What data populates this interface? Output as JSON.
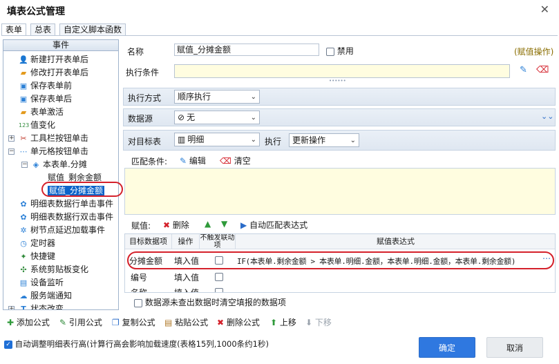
{
  "window": {
    "title": "填表公式管理",
    "close": "✕"
  },
  "tabs": [
    "表单",
    "总表",
    "自定义脚本函数"
  ],
  "tree": {
    "header": "事件",
    "items": [
      {
        "label": "新建打开表单后",
        "icon": "user-add-icon"
      },
      {
        "label": "修改打开表单后",
        "icon": "folder-open-icon"
      },
      {
        "label": "保存表单前",
        "icon": "save-icon"
      },
      {
        "label": "保存表单后",
        "icon": "save-done-icon"
      },
      {
        "label": "表单激活",
        "icon": "folder-icon"
      },
      {
        "label": "值变化",
        "icon": "number-icon"
      },
      {
        "label": "工具栏按钮单击",
        "icon": "tools-icon"
      },
      {
        "label": "单元格按钮单击",
        "icon": "dots-icon"
      },
      {
        "label": "本表单.分摊",
        "icon": "layers-icon"
      },
      {
        "label": "赋值_剩余金额",
        "icon": ""
      },
      {
        "label": "赋值_分摊金额",
        "icon": ""
      },
      {
        "label": "明细表数据行单击事件",
        "icon": "gear-icon"
      },
      {
        "label": "明细表数据行双击事件",
        "icon": "gear-icon"
      },
      {
        "label": "树节点延迟加载事件",
        "icon": "tree-icon"
      },
      {
        "label": "定时器",
        "icon": "timer-icon"
      },
      {
        "label": "快捷键",
        "icon": "shortcut-icon"
      },
      {
        "label": "系统剪贴板变化",
        "icon": "clipboard-icon"
      },
      {
        "label": "设备监听",
        "icon": "device-icon"
      },
      {
        "label": "服务端通知",
        "icon": "server-icon"
      },
      {
        "label": "状态改变",
        "icon": "state-icon"
      }
    ]
  },
  "form": {
    "name_label": "名称",
    "name_value": "赋值_分摊金额",
    "disable_label": "禁用",
    "kind_label": "(赋值操作)",
    "condition_label": "执行条件",
    "exec_mode_label": "执行方式",
    "exec_mode_value": "顺序执行",
    "datasource_label": "数据源",
    "datasource_value": "无",
    "target_label": "对目标表",
    "target_value": "明细",
    "exec_label": "执行",
    "exec_value": "更新操作",
    "match_label": "匹配条件:",
    "edit_label": "编辑",
    "clear_label": "清空",
    "assign_label": "赋值:",
    "delete_label": "删除",
    "auto_match_label": "自动匹配表达式"
  },
  "grid": {
    "headers": [
      "目标数据项",
      "操作",
      "不触发联动项",
      "赋值表达式"
    ],
    "rows": [
      {
        "target": "分摊金额",
        "op": "填入值",
        "expr": "IF(本表单.剩余金额 > 本表单.明细.金额，本表单.明细.金额，本表单.剩余金额)"
      },
      {
        "target": "编号",
        "op": "填入值",
        "expr": ""
      },
      {
        "target": "名称",
        "op": "填入值",
        "expr": ""
      }
    ],
    "ds_clear_label": "数据源未查出数据时清空填报的数据项"
  },
  "toolbar": {
    "add": "添加公式",
    "ref": "引用公式",
    "copy": "复制公式",
    "paste": "粘贴公式",
    "delete": "删除公式",
    "up": "上移",
    "down": "下移"
  },
  "footer": {
    "auto_adjust": "自动调整明细表行高(计算行高会影响加载速度(表格15列,1000条约1秒)",
    "ok": "确定",
    "cancel": "取消"
  },
  "colors": {
    "accent": "#2f78e0",
    "highlight": "#d4202a",
    "selection": "#0b63c9",
    "kind": "#8a6d00"
  }
}
